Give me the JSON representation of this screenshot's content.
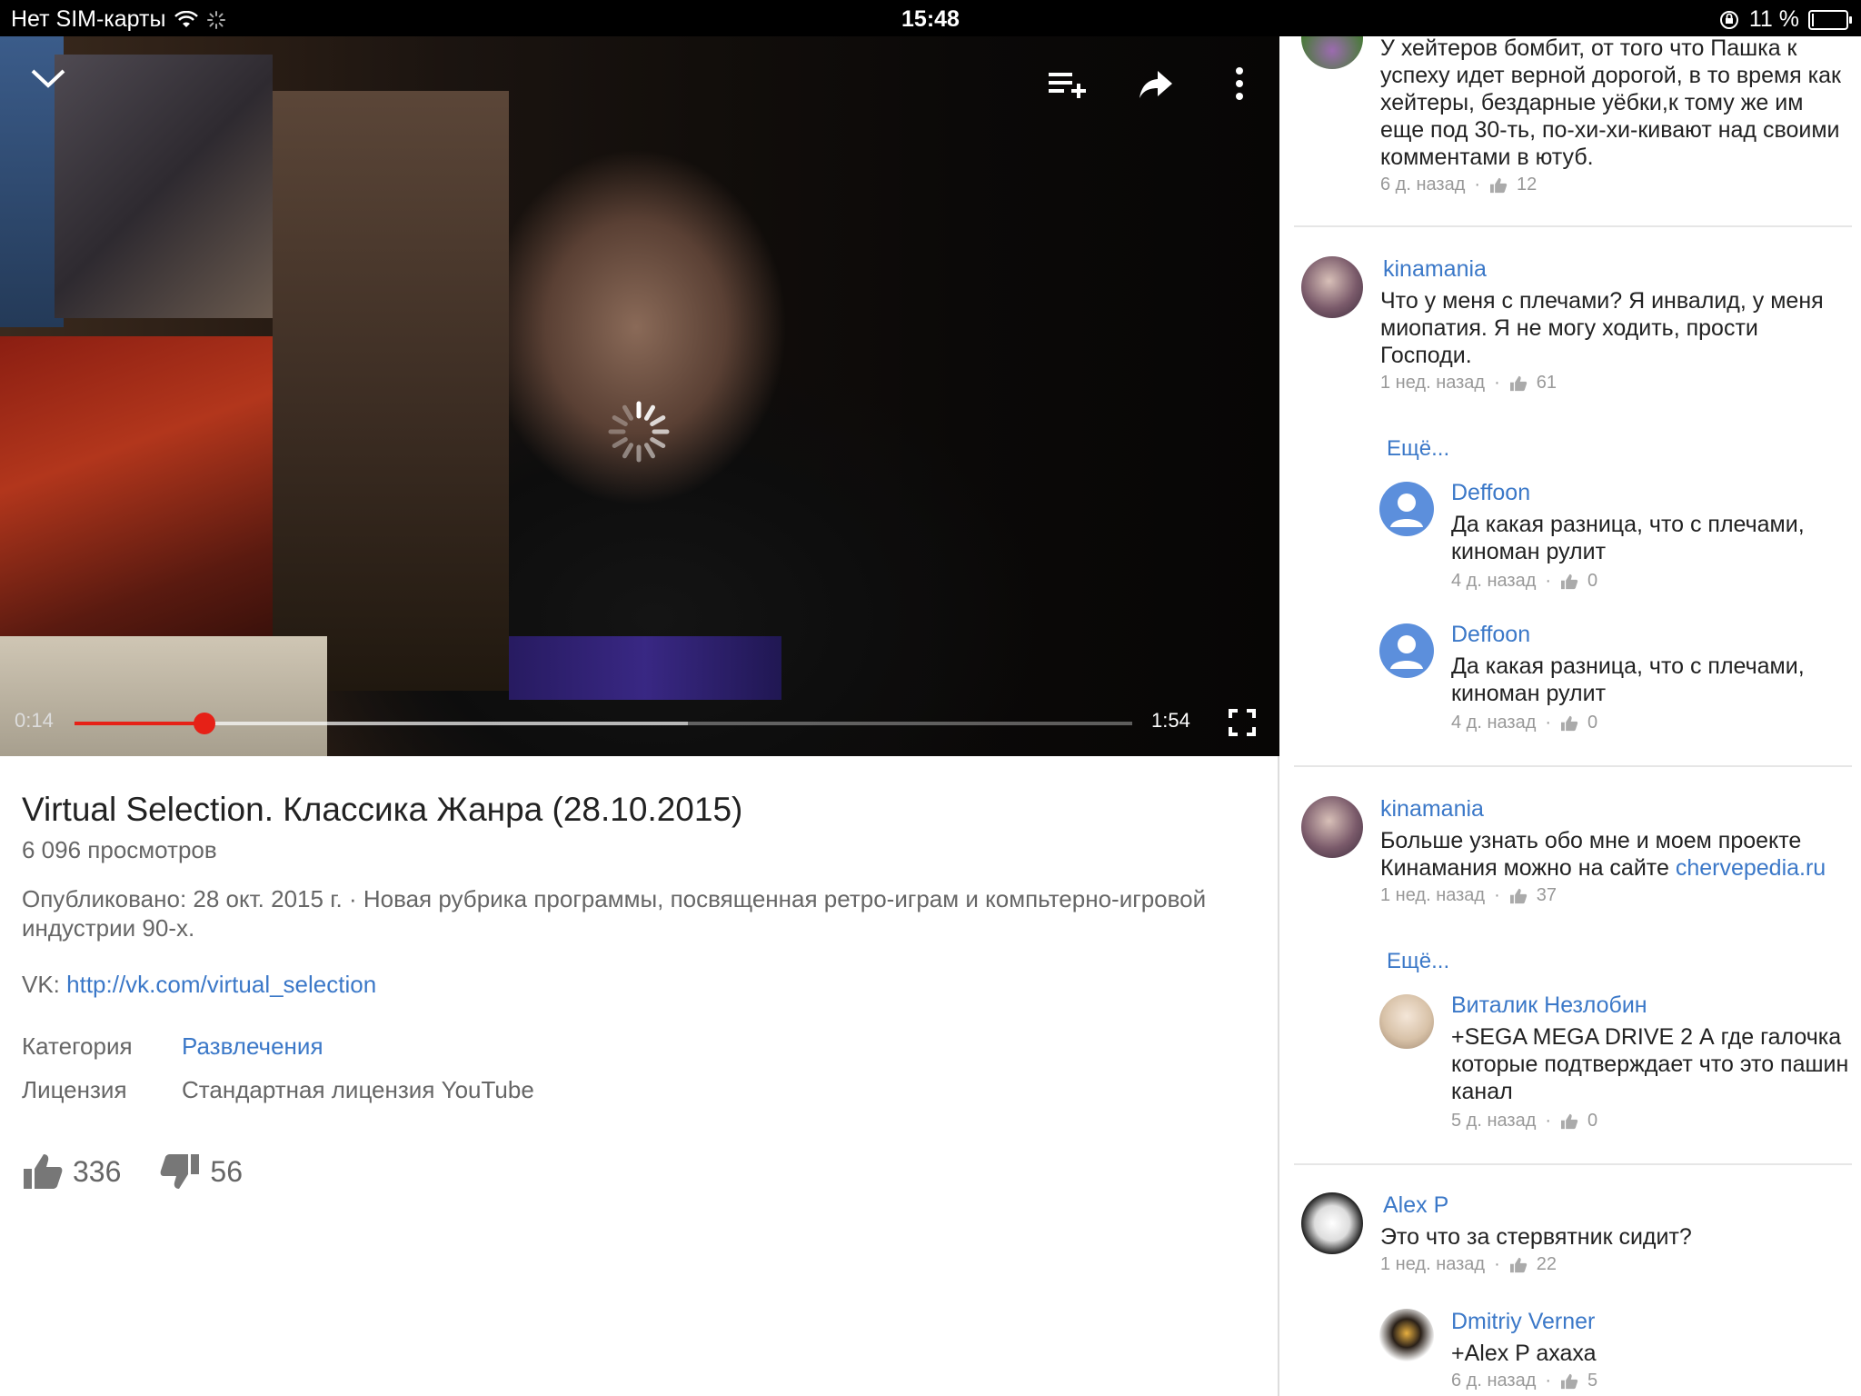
{
  "status_bar": {
    "carrier": "Нет SIM-карты",
    "time": "15:48",
    "battery": "11 %",
    "battery_level": 0.11
  },
  "video": {
    "current_time": "0:14",
    "duration": "1:54",
    "progress": 0.123,
    "buffered": 0.58,
    "buttons": {
      "minimize": "chevron-down-icon",
      "add_to_playlist": "playlist-add-icon",
      "share": "share-icon",
      "more": "more-vert-icon",
      "fullscreen": "fullscreen-icon"
    }
  },
  "info": {
    "title": "Virtual Selection. Классика Жанра (28.10.2015)",
    "views": "6 096 просмотров",
    "description": "Опубликовано: 28 окт. 2015 г. · Новая рубрика программы, посвященная ретро-играм и компьтерно-игровой индустрии 90-х.",
    "vk_label": "VK: ",
    "vk_link": "http://vk.com/virtual_selection",
    "category_label": "Категория",
    "category_value": "Развлечения",
    "license_label": "Лицензия",
    "license_value": "Стандартная лицензия YouTube",
    "likes": "336",
    "dislikes": "56"
  },
  "comments": {
    "c0": {
      "text": "У хейтеров бомбит, от того что Пашка к успеху идет верной дорогой, в то время как хейтеры, бездарные уёбки,к тому же им еще под 30-ть, по-хи-хи-кивают над своими комментами в ютуб.",
      "time": "6 д. назад",
      "likes": "12"
    },
    "c1": {
      "author": "kinamania",
      "text": "Что у меня с плечами? Я инвалид, у меня миопатия. Я не могу ходить, прости Господи.",
      "time": "1 нед. назад",
      "likes": "61"
    },
    "more1": "Ещё...",
    "r1": {
      "author": "Deffoon",
      "text": "Да какая разница, что с плечами, киноман рулит",
      "time": "4 д. назад",
      "likes": "0"
    },
    "r2": {
      "author": "Deffoon",
      "text": "Да какая разница, что с плечами, киноман рулит",
      "time": "4 д. назад",
      "likes": "0"
    },
    "c2": {
      "author": "kinamania",
      "text_before": "Больше узнать обо мне и моем проекте Кинамания можно на сайте ",
      "link": "chervepedia.ru",
      "time": "1 нед. назад",
      "likes": "37"
    },
    "more2": "Ещё...",
    "r3": {
      "author": "Виталик Незлобин",
      "text": "+SEGA MEGA DRIVE 2 А где галочка которые подтверждает что это пашин канал",
      "time": "5 д. назад",
      "likes": "0"
    },
    "c3": {
      "author": "Alex P",
      "text": "Это что за стервятник сидит?",
      "time": "1 нед. назад",
      "likes": "22"
    },
    "r4": {
      "author": "Dmitriy Verner",
      "text": "+Alex P ахаха",
      "time": "6 д. назад",
      "likes": "5"
    },
    "dot": "·"
  }
}
